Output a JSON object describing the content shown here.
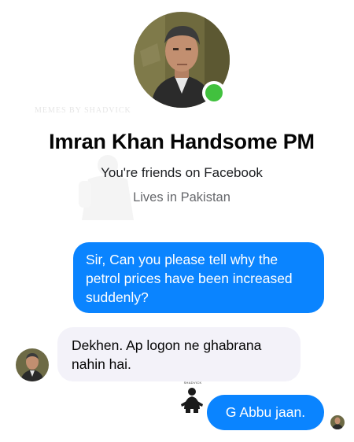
{
  "watermark": "MEMES BY SHADVICK",
  "profile": {
    "name": "Imran Khan Handsome PM",
    "friends_text": "You're friends on Facebook",
    "location_text": "Lives in Pakistan",
    "online": true
  },
  "messages": [
    {
      "from": "me",
      "text": "Sir, Can you please tell why the petrol prices have been increased suddenly?"
    },
    {
      "from": "contact",
      "text": "Dekhen. Ap logon ne ghabrana nahin hai."
    },
    {
      "from": "me",
      "text": "G Abbu jaan."
    }
  ],
  "sticker": {
    "caption": "SHADVICK"
  },
  "colors": {
    "outgoing_bubble": "#0a84ff",
    "incoming_bubble": "#f3f2f9",
    "online_dot": "#41c13e",
    "secondary_text": "#65676b"
  }
}
